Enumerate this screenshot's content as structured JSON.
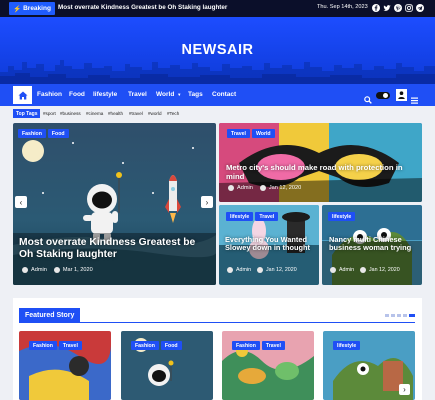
{
  "topbar": {
    "breaking_label": "Breaking",
    "ticker": "Most overrate Kindness Greatest be Oh Staking laughter",
    "date": "Thu. Sep 14th, 2023",
    "social_icons": [
      "facebook-icon",
      "twitter-icon",
      "pinterest-icon",
      "instagram-icon",
      "telegram-icon"
    ]
  },
  "site": {
    "name": "NEWSAIR"
  },
  "nav": {
    "items": [
      "Fashion",
      "Food",
      "lifestyle",
      "Travel",
      "World",
      "Tags",
      "Contact"
    ],
    "world_has_dropdown": true
  },
  "tags": {
    "label": "Top Tags",
    "items": [
      "#sport",
      "#business",
      "#cinema",
      "#health",
      "#travel",
      "#world",
      "#Tech"
    ]
  },
  "hero_main": {
    "categories": [
      "Fashion",
      "Food"
    ],
    "title": "Most overrate Kindness Greatest be Oh Staking laughter",
    "author": "Admin",
    "date": "Mar 1, 2020"
  },
  "hero_top_right": {
    "categories": [
      "Travel",
      "World"
    ],
    "title": "Metro city's should make road with protection in mind",
    "author": "Admin",
    "date": "Jan 12, 2020"
  },
  "hero_bottom_left": {
    "categories": [
      "lifestyle",
      "Travel"
    ],
    "title": "Everything You Wanted Slowey down in thought",
    "author": "Admin",
    "date": "Jan 12, 2020"
  },
  "hero_bottom_right": {
    "categories": [
      "lifestyle"
    ],
    "title": "Nancy multi Chinese business woman trying",
    "author": "Admin",
    "date": "Jan 12, 2020"
  },
  "featured": {
    "label": "Featured Story",
    "cards": [
      {
        "categories": [
          "Fashion",
          "Travel"
        ]
      },
      {
        "categories": [
          "Fashion",
          "Food"
        ]
      },
      {
        "categories": [
          "Fashion",
          "Travel"
        ]
      },
      {
        "categories": [
          "lifestyle"
        ]
      }
    ]
  },
  "colors": {
    "accent": "#1f4ff5",
    "topbar": "#0b0f2a",
    "background": "#eef0f5"
  }
}
